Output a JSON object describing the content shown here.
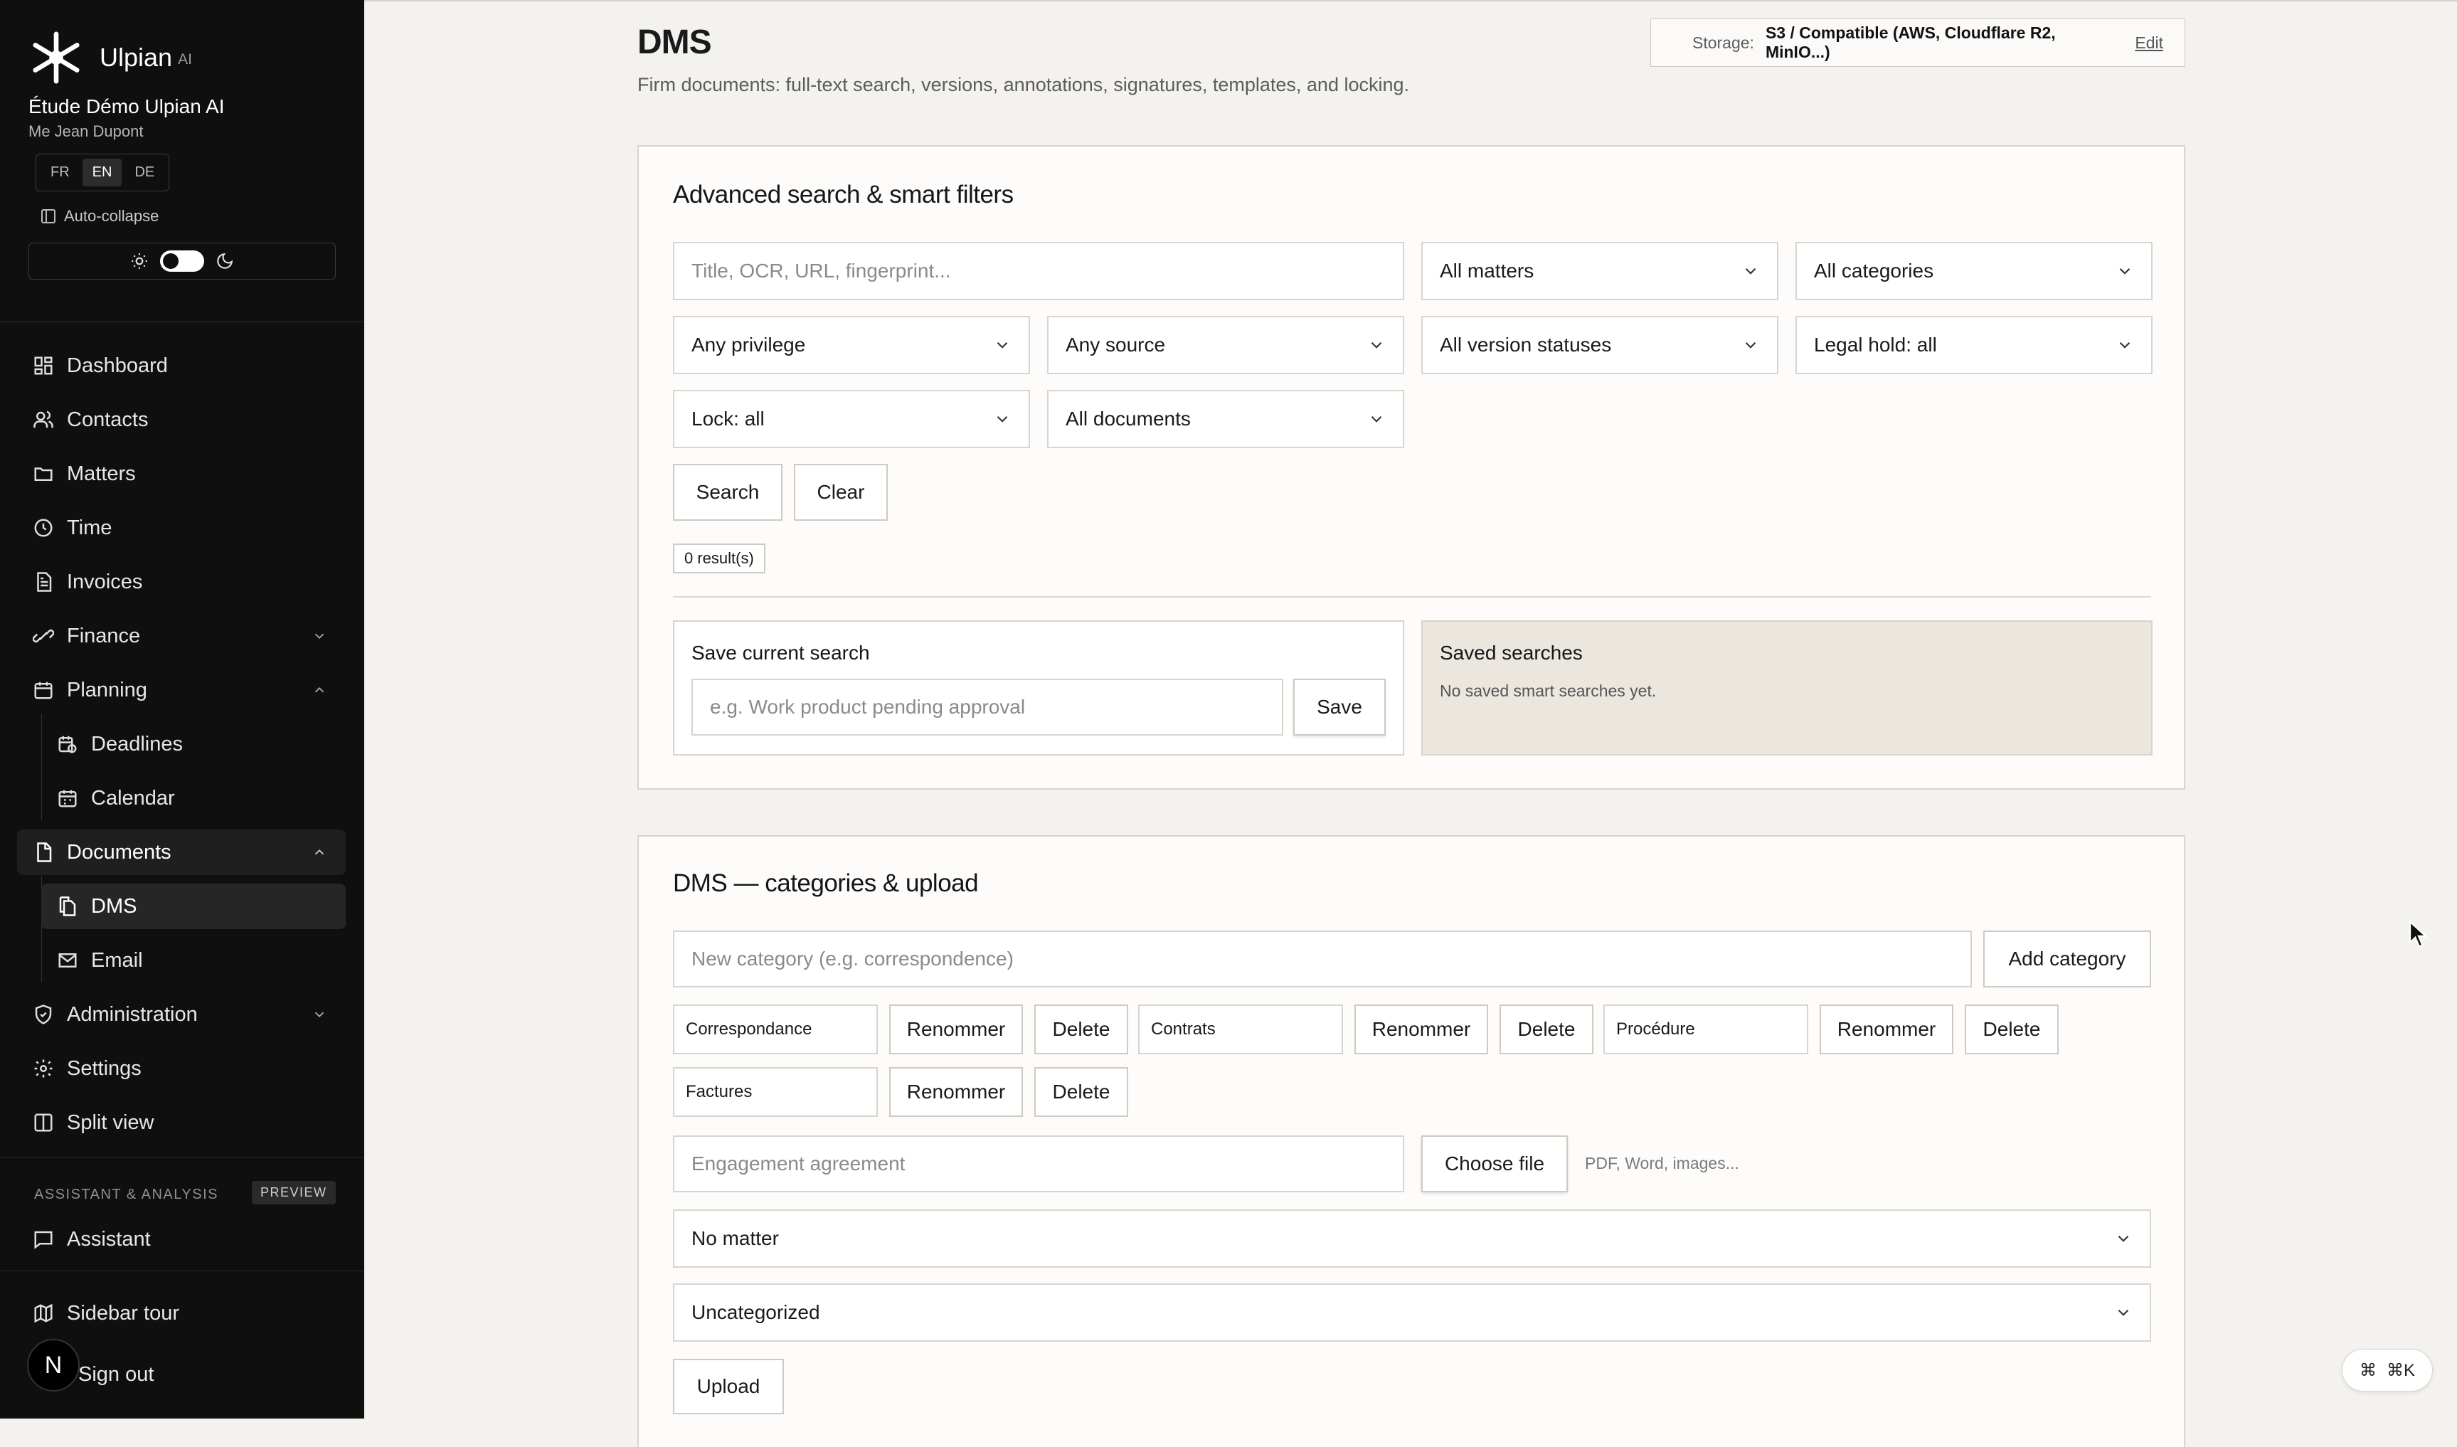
{
  "sidebar": {
    "brand": {
      "name": "Ulpian",
      "suffix": "AI"
    },
    "firm": "Étude Démo Ulpian AI",
    "user": "Me Jean Dupont",
    "languages": [
      "FR",
      "EN",
      "DE"
    ],
    "active_language": "EN",
    "auto_collapse_label": "Auto-collapse",
    "nav": {
      "dashboard": "Dashboard",
      "contacts": "Contacts",
      "matters": "Matters",
      "time": "Time",
      "invoices": "Invoices",
      "finance": "Finance",
      "planning": "Planning",
      "deadlines": "Deadlines",
      "calendar": "Calendar",
      "documents": "Documents",
      "dms": "DMS",
      "email": "Email",
      "administration": "Administration",
      "settings": "Settings",
      "split_view": "Split view"
    },
    "section_label": "ASSISTANT & ANALYSIS",
    "preview_badge": "PREVIEW",
    "assistant": "Assistant",
    "sidebar_tour": "Sidebar tour",
    "avatar_initial": "N",
    "sign_out": "Sign out"
  },
  "header": {
    "title": "DMS",
    "subtitle": "Firm documents: full-text search, versions, annotations, signatures, templates, and locking.",
    "storage_label": "Storage:",
    "storage_value": "S3 / Compatible (AWS, Cloudflare R2, MinIO...)",
    "storage_edit": "Edit"
  },
  "search": {
    "title": "Advanced search & smart filters",
    "query_placeholder": "Title, OCR, URL, fingerprint...",
    "filters": {
      "matters": "All matters",
      "categories": "All categories",
      "privilege": "Any privilege",
      "source": "Any source",
      "version_status": "All version statuses",
      "legal_hold": "Legal hold: all",
      "lock": "Lock: all",
      "documents": "All documents"
    },
    "search_button": "Search",
    "clear_button": "Clear",
    "result_count": "0 result(s)",
    "save_title": "Save current search",
    "save_placeholder": "e.g. Work product pending approval",
    "save_button": "Save",
    "saved_title": "Saved searches",
    "saved_empty": "No saved smart searches yet."
  },
  "categories": {
    "title": "DMS — categories & upload",
    "new_placeholder": "New category (e.g. correspondence)",
    "add_button": "Add category",
    "rename_label": "Renommer",
    "delete_label": "Delete",
    "items": [
      "Correspondance",
      "Contrats",
      "Procédure",
      "Factures"
    ]
  },
  "upload": {
    "title_placeholder": "Engagement agreement",
    "choose_file": "Choose file",
    "file_hint": "PDF, Word, images...",
    "matter_select": "No matter",
    "category_select": "Uncategorized",
    "upload_button": "Upload"
  },
  "command_palette": {
    "label": "⌘K"
  },
  "colors": {
    "sidebar_bg": "#0f0f0f",
    "page_bg": "#f4f2ee",
    "saved_panel_bg": "#ebe6de"
  }
}
